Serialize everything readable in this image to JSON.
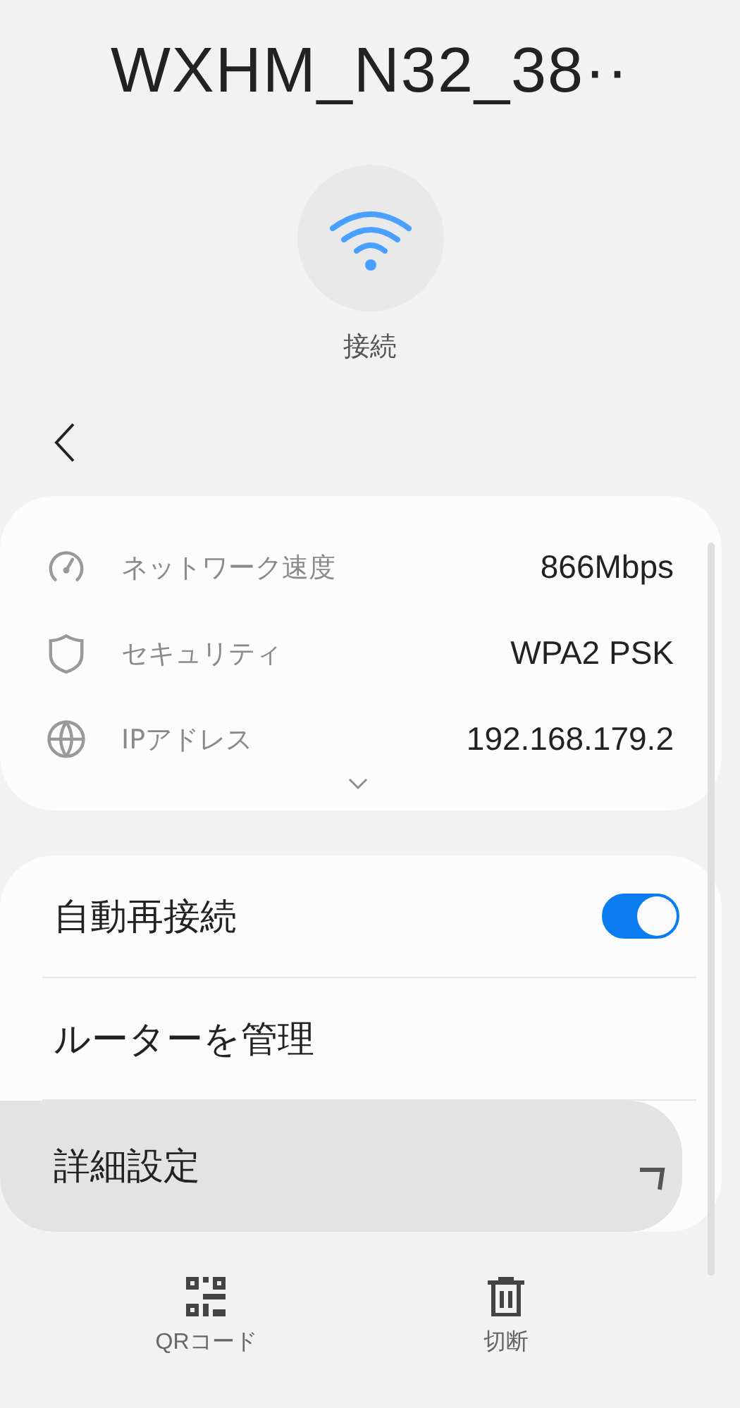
{
  "title": "WXHM_N32_38··",
  "status": {
    "label": "接続"
  },
  "info": {
    "rows": [
      {
        "kind": "speed",
        "label": "ネットワーク速度",
        "value": "866Mbps"
      },
      {
        "kind": "shield",
        "label": "セキュリティ",
        "value": "WPA2 PSK"
      },
      {
        "kind": "globe",
        "label": "IPアドレス",
        "value": "192.168.179.2"
      }
    ],
    "expanded": false
  },
  "settings": [
    {
      "kind": "toggle",
      "label": "自動再接続",
      "on": true,
      "selected": false
    },
    {
      "kind": "link",
      "label": "ルーターを管理",
      "selected": false
    },
    {
      "kind": "link",
      "label": "詳細設定",
      "selected": true
    }
  ],
  "actions": [
    {
      "kind": "qr",
      "label": "QRコード"
    },
    {
      "kind": "trash",
      "label": "切断"
    }
  ]
}
